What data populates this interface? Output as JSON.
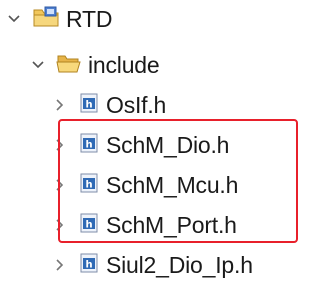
{
  "tree": {
    "root": {
      "label": "RTD",
      "expanded": true,
      "icon": "project-folder-icon"
    },
    "folder": {
      "label": "include",
      "expanded": true,
      "icon": "open-folder-icon"
    },
    "files": [
      {
        "label": "OsIf.h",
        "icon": "header-file-icon",
        "highlighted": false
      },
      {
        "label": "SchM_Dio.h",
        "icon": "header-file-icon",
        "highlighted": true
      },
      {
        "label": "SchM_Mcu.h",
        "icon": "header-file-icon",
        "highlighted": true
      },
      {
        "label": "SchM_Port.h",
        "icon": "header-file-icon",
        "highlighted": true
      },
      {
        "label": "Siul2_Dio_Ip.h",
        "icon": "header-file-icon",
        "highlighted": false
      }
    ],
    "highlight_color": "#e8202b",
    "folder_color": "#e9b84a",
    "header_icon_color": "#2f6ab5"
  }
}
